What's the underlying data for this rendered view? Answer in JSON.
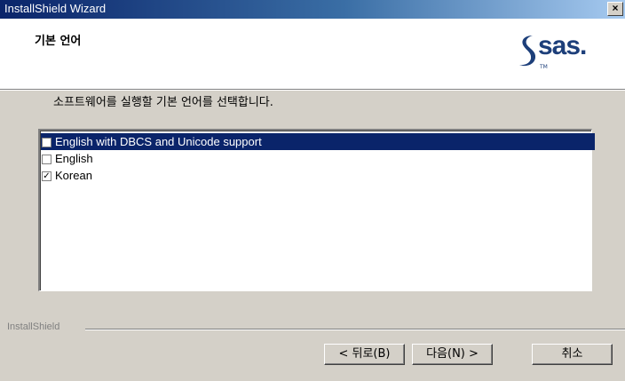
{
  "window": {
    "title": "InstallShield Wizard",
    "close_label": "×"
  },
  "header": {
    "heading": "기본 언어",
    "logo_text": "sas.",
    "logo_tm": "TM"
  },
  "instruction": "소프트웨어를 실행할 기본 언어를 선택합니다.",
  "languages": [
    {
      "label": "English with DBCS and Unicode support",
      "checked": false,
      "selected": true
    },
    {
      "label": "English",
      "checked": false,
      "selected": false
    },
    {
      "label": "Korean",
      "checked": true,
      "selected": false
    }
  ],
  "footer": {
    "brand": "InstallShield",
    "back_label": "< 뒤로(B)",
    "next_label": "다음(N) >",
    "cancel_label": "취소"
  },
  "colors": {
    "title_bar": "#0a246a",
    "selection": "#0a246a",
    "logo": "#1d3f7a"
  }
}
